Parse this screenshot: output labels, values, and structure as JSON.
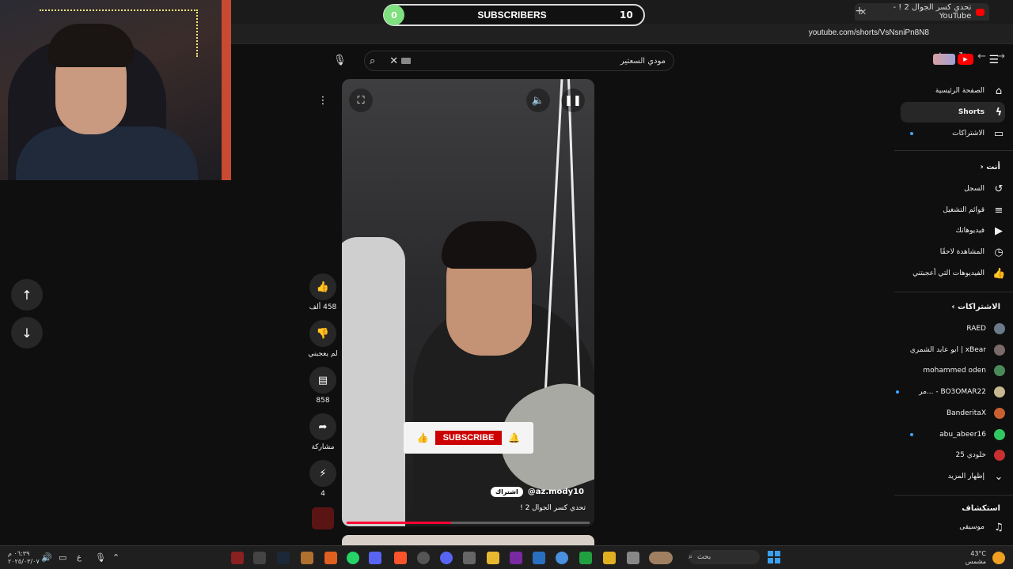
{
  "browser": {
    "tab_title": "تحدي كسر الجوال 2 ! - YouTube",
    "url": "youtube.com/shorts/VsNsniPn8N8"
  },
  "overlay": {
    "subscriber_start": "0",
    "subscriber_label": "SUBSCRIBERS",
    "subscriber_goal": "10"
  },
  "header": {
    "search_value": "مودي السعتير"
  },
  "short": {
    "like_count": "458 ألف",
    "dislike_label": "لم يعجبني",
    "comment_count": "858",
    "share_label": "مشاركة",
    "remix_count": "4",
    "channel_handle": "@az.mody10",
    "subscribe_pill": "اشتراك",
    "video_title": "تحدي كسر الجوال 2 !",
    "overlay_subscribe": "SUBSCRIBE",
    "progress": 0.43
  },
  "sidebar": {
    "main": [
      {
        "label": "الصفحة الرئيسية",
        "icon": "home-icon"
      },
      {
        "label": "Shorts",
        "icon": "shorts-icon"
      },
      {
        "label": "الاشتراكات",
        "icon": "subscriptions-icon"
      }
    ],
    "you_heading": "أنت",
    "you": [
      {
        "label": "السجل",
        "icon": "history-icon"
      },
      {
        "label": "قوائم التشغيل",
        "icon": "playlists-icon"
      },
      {
        "label": "فيديوهاتك",
        "icon": "your-videos-icon"
      },
      {
        "label": "المشاهدة لاحقًا",
        "icon": "watch-later-icon"
      },
      {
        "label": "الفيديوهات التي أعجبتني",
        "icon": "liked-icon"
      }
    ],
    "subs_heading": "الاشتراكات",
    "subscriptions": [
      {
        "label": "RAED",
        "color": "#6a7a8a"
      },
      {
        "label": "xBear | ابو عابد الشمري",
        "color": "#7a6a6a"
      },
      {
        "label": "mohammed oden",
        "color": "#4a8a5a"
      },
      {
        "label": "BO3OMAR22 - ...مر",
        "color": "#c8b890"
      },
      {
        "label": "BanderitaX",
        "color": "#c86030"
      },
      {
        "label": "abu_abeer16",
        "color": "#30c860"
      },
      {
        "label": "خلودي 25",
        "color": "#c83030"
      }
    ],
    "show_more": "إظهار المزيد",
    "explore_heading": "استكشاف",
    "explore": [
      {
        "label": "موسيقى",
        "icon": "music-icon"
      }
    ]
  },
  "taskbar": {
    "search_label": "بحث",
    "weather_temp": "43°C",
    "weather_desc": "مشمس",
    "time": "٠٦:٣٩ م",
    "date": "٢٠٢٥/٠٣/٠٧",
    "lang": "ع"
  }
}
